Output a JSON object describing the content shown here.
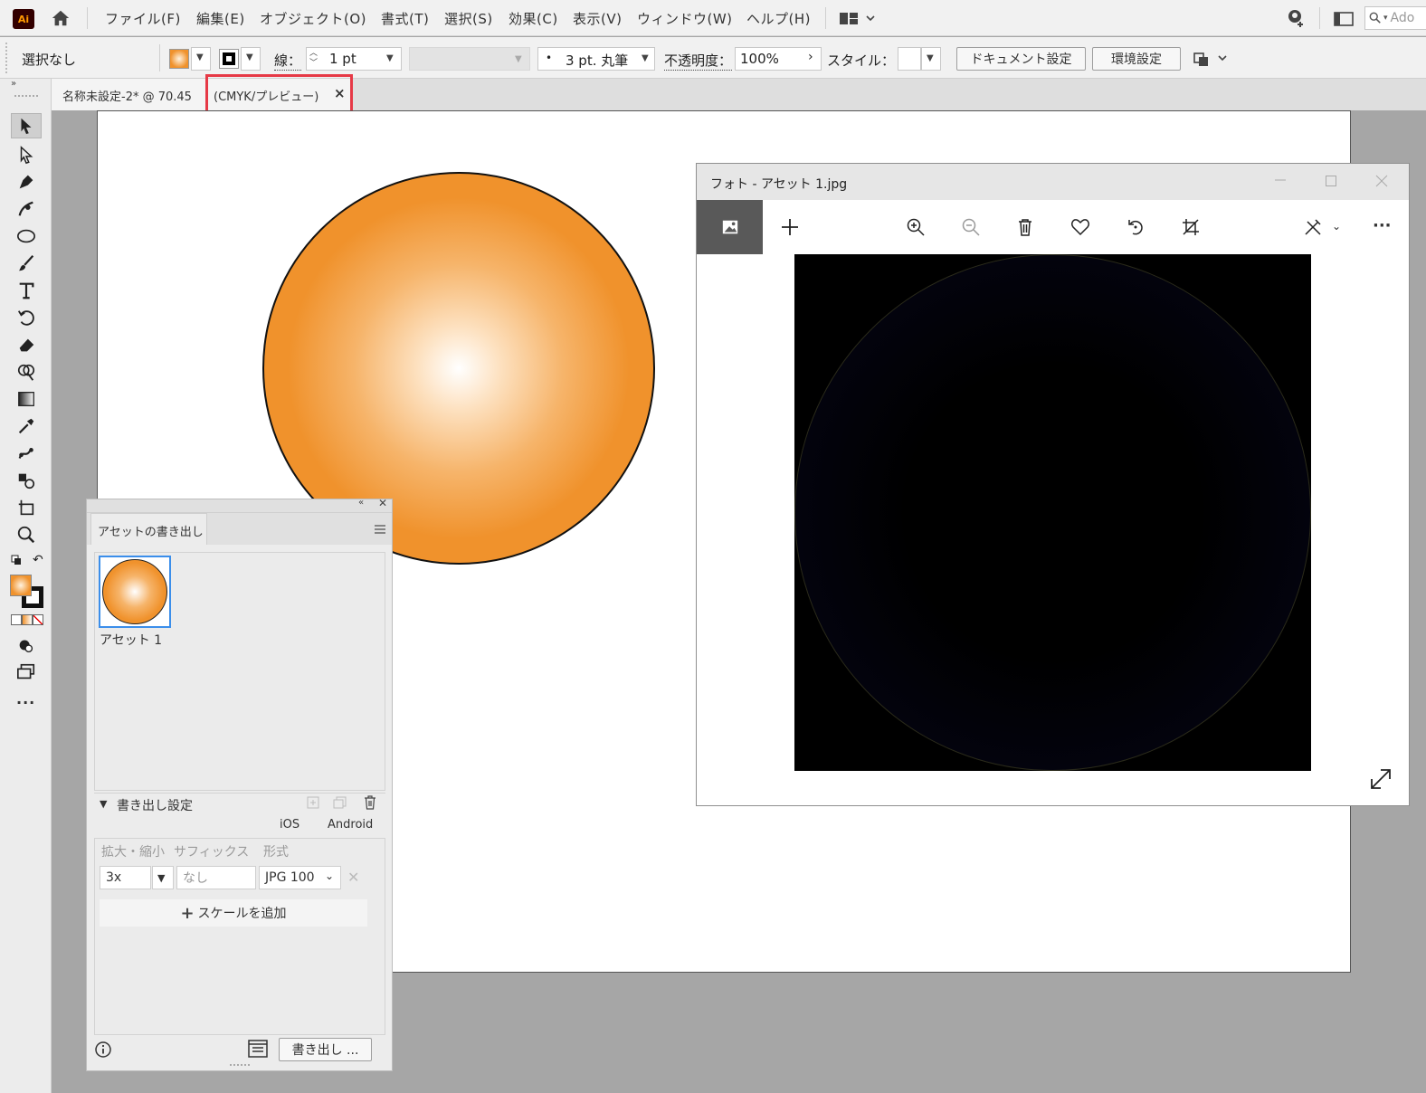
{
  "menubar": {
    "logo": "Ai",
    "items": [
      "ファイル(F)",
      "編集(E)",
      "オブジェクト(O)",
      "書式(T)",
      "選択(S)",
      "効果(C)",
      "表示(V)",
      "ウィンドウ(W)",
      "ヘルプ(H)"
    ],
    "search_placeholder": "Ado"
  },
  "controlbar": {
    "selection_label": "選択なし",
    "stroke_label": "線：",
    "stroke_weight": "1 pt",
    "brush_label": "3 pt. 丸筆",
    "opacity_label": "不透明度：",
    "opacity_value": "100%",
    "style_label": "スタイル：",
    "doc_settings": "ドキュメント設定",
    "preferences": "環境設定"
  },
  "document_tab": {
    "title": "名称未設定-2* @ 70.45",
    "mode": "(CMYK/プレビュー)",
    "close": "×"
  },
  "photos": {
    "title": "フォト - アセット 1.jpg",
    "more": "···"
  },
  "asset_panel": {
    "tab_label": "アセットの書き出し",
    "asset_name": "アセット 1",
    "export_settings": "書き出し設定",
    "ios": "iOS",
    "android": "Android",
    "col_scale": "拡大・縮小",
    "col_suffix": "サフィックス",
    "col_format": "形式",
    "scale_value": "3x",
    "suffix_placeholder": "なし",
    "format_value": "JPG 100",
    "add_scale": "スケールを追加",
    "export_button": "書き出し ..."
  },
  "colors": {
    "accent_orange": "#f0922c",
    "highlight_red": "#e63946",
    "photo_bg": "#000000"
  }
}
